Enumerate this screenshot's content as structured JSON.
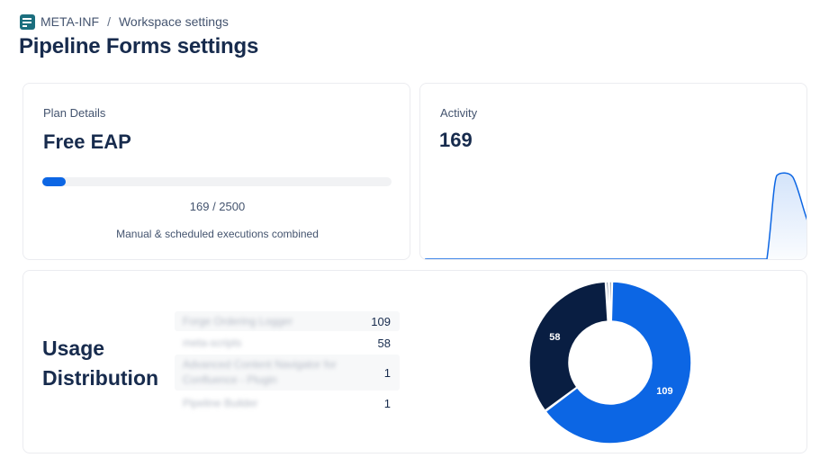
{
  "breadcrumb": {
    "app_name": "META-INF",
    "separator": "/",
    "current": "Workspace settings"
  },
  "page": {
    "title": "Pipeline Forms settings"
  },
  "plan": {
    "label": "Plan Details",
    "name": "Free EAP",
    "used": 169,
    "limit": 2500,
    "usage_text": "169 / 2500",
    "note": "Manual & scheduled executions combined"
  },
  "activity": {
    "label": "Activity",
    "value": "169",
    "line_color": "#0c66e4"
  },
  "usage": {
    "title": "Usage Distribution",
    "rows": [
      {
        "name": "Forge Ordering Logger",
        "count": "109"
      },
      {
        "name": "meta-scripts",
        "count": "58"
      },
      {
        "name": "Advanced Content Navigator for Confluence - Plugin",
        "count": "1"
      },
      {
        "name": "Pipeline Builder",
        "count": "1"
      }
    ]
  },
  "chart_data": {
    "type": "pie",
    "categories": [
      "Forge Ordering Logger",
      "meta-scripts",
      "Advanced Content Navigator for Confluence - Plugin",
      "Pipeline Builder"
    ],
    "values": [
      109,
      58,
      1,
      1
    ],
    "labels_shown": [
      "109",
      "58"
    ],
    "colors": [
      "#0c66e4",
      "#091e42",
      "#091e42",
      "#091e42"
    ],
    "donut": true
  }
}
